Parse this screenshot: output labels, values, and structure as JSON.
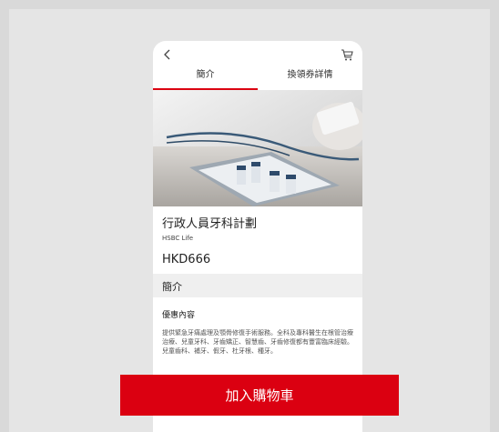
{
  "nav": {
    "back_icon": "chevron-left-icon",
    "cart_icon": "shopping-cart-icon"
  },
  "tabs": [
    {
      "label": "簡介",
      "active": true
    },
    {
      "label": "換領券詳情",
      "active": false
    }
  ],
  "product": {
    "title": "行政人員牙科計劃",
    "issuer": "HSBC Life",
    "price": "HKD666"
  },
  "section": {
    "heading": "簡介",
    "offer_label": "優惠內容",
    "offer_text": "提供緊急牙痛處理及顎骨修復手術服務。全科及專科醫生在根管治療治療、兒童牙科、牙齒矯正、智慧齒、牙齒修復都有豐富臨床經驗。兒童齒科、補牙、假牙、杜牙根、種牙。"
  },
  "cta": {
    "label": "加入購物車"
  },
  "colors": {
    "accent": "#db0011",
    "background": "#e5e5e5",
    "section_bg": "#efefef"
  }
}
